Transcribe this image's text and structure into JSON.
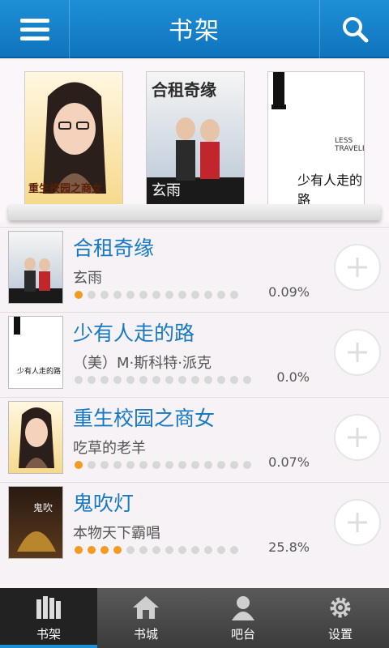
{
  "header": {
    "title": "书架"
  },
  "shelf": {
    "covers": [
      {
        "caption": "重生校园之商女"
      },
      {
        "caption": "玄雨",
        "title": "合租奇缘"
      },
      {
        "caption": "少有人走的路",
        "subtitle": "LESS TRAVELED"
      }
    ]
  },
  "books": [
    {
      "title": "合租奇缘",
      "author": "玄雨",
      "progress": "0.09%",
      "dots_on": 1
    },
    {
      "title": "少有人走的路",
      "author": "（美）M·斯科特·派克",
      "progress": "0.0%",
      "dots_on": 0
    },
    {
      "title": "重生校园之商女",
      "author": "吃草的老羊",
      "progress": "0.07%",
      "dots_on": 1
    },
    {
      "title": "鬼吹灯",
      "author": "本物天下霸唱",
      "progress": "25.8%",
      "dots_on": 4
    }
  ],
  "tabs": [
    {
      "label": "书架",
      "icon": "bookshelf-icon"
    },
    {
      "label": "书城",
      "icon": "home-icon"
    },
    {
      "label": "吧台",
      "icon": "user-icon"
    },
    {
      "label": "设置",
      "icon": "gear-icon"
    }
  ],
  "colors": {
    "accent": "#1e8fd6",
    "progress": "#f29a22"
  }
}
